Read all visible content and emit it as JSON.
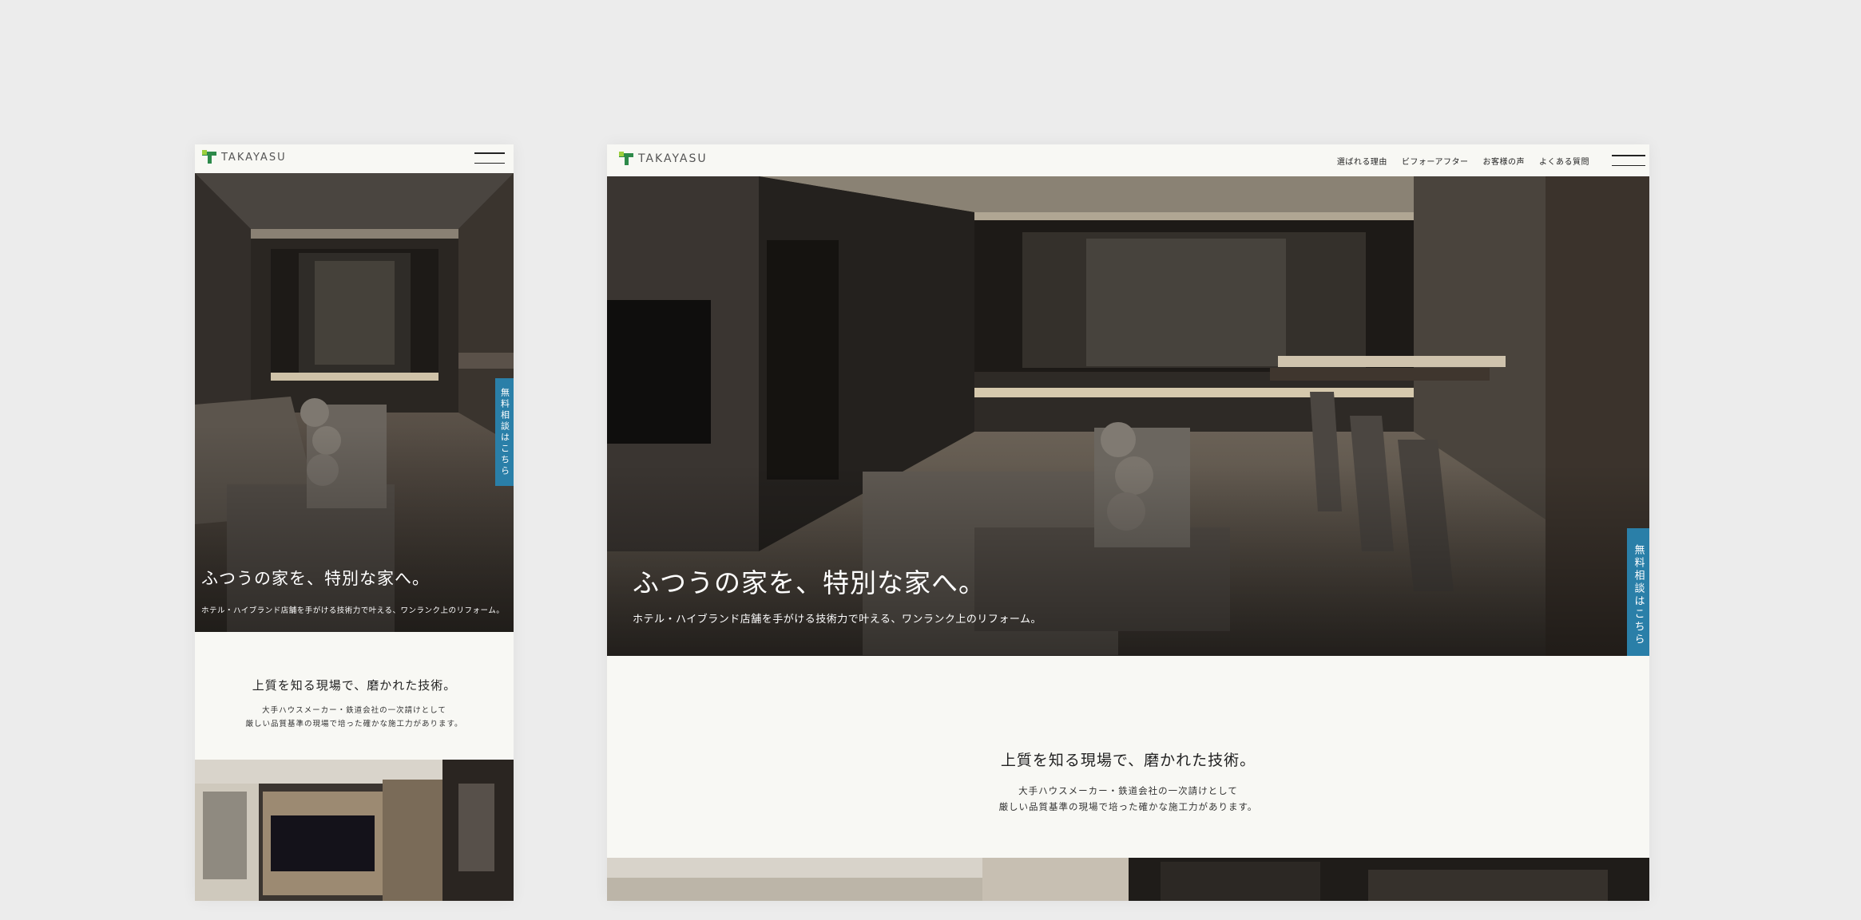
{
  "brand": {
    "name": "TAKAYASU"
  },
  "nav": {
    "items": [
      "選ばれる理由",
      "ビフォーアフター",
      "お客様の声",
      "よくある質問"
    ]
  },
  "hero": {
    "title": "ふつうの家を、特別な家へ。",
    "subtitle": "ホテル・ハイブランド店舗を手がける技術力で叶える、ワンランク上のリフォーム。"
  },
  "consult_tab": {
    "label": "無料相談はこちら"
  },
  "section": {
    "heading": "上質を知る現場で、磨かれた技術。",
    "lines": [
      "大手ハウスメーカー・鉄道会社の一次請けとして",
      "厳しい品質基準の現場で培った確かな施工力があります。"
    ]
  },
  "icons": {
    "logo": "takayasu-logo-mark",
    "menu": "hamburger-menu-icon"
  },
  "colors": {
    "accent_blue": "#2a7fa8",
    "logo_green": "#2d8a4a",
    "logo_lime": "#9ccf3d",
    "page_bg": "#ececec",
    "panel_bg": "#f8f8f4"
  }
}
